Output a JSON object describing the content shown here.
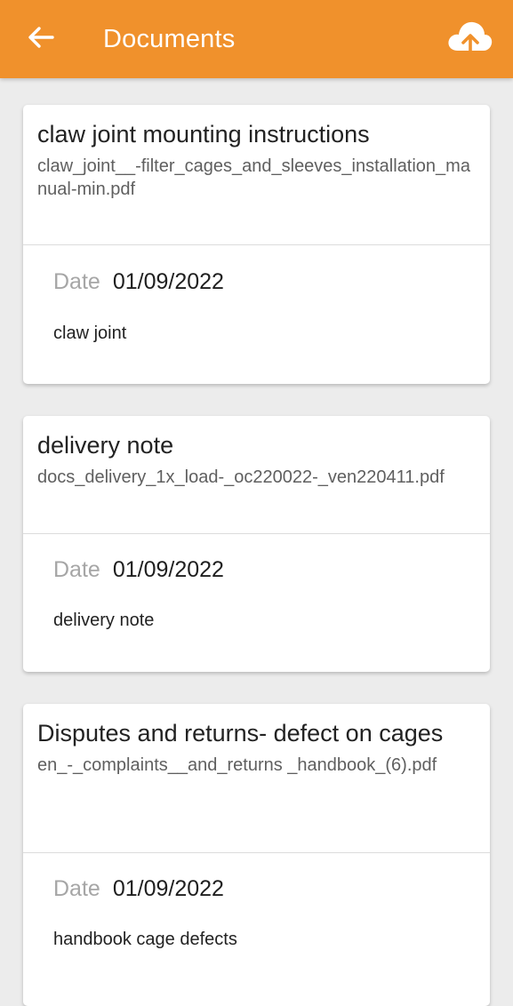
{
  "appbar": {
    "title": "Documents",
    "back_icon": "arrow-left-icon",
    "upload_icon": "cloud-upload-icon",
    "color": "#f0912c"
  },
  "documents": [
    {
      "title": "claw joint mounting instructions",
      "filename": "claw_joint__-filter_cages_and_sleeves_installation_manual-min.pdf",
      "date_label": "Date",
      "date": "01/09/2022",
      "description": "claw joint"
    },
    {
      "title": "delivery note",
      "filename": "docs_delivery_1x_load-_oc220022-_ven220411.pdf",
      "date_label": "Date",
      "date": "01/09/2022",
      "description": "delivery note"
    },
    {
      "title": "Disputes and returns- defect on cages",
      "filename": "en_-_complaints__and_returns _handbook_(6).pdf",
      "date_label": "Date",
      "date": "01/09/2022",
      "description": "handbook cage defects"
    }
  ]
}
